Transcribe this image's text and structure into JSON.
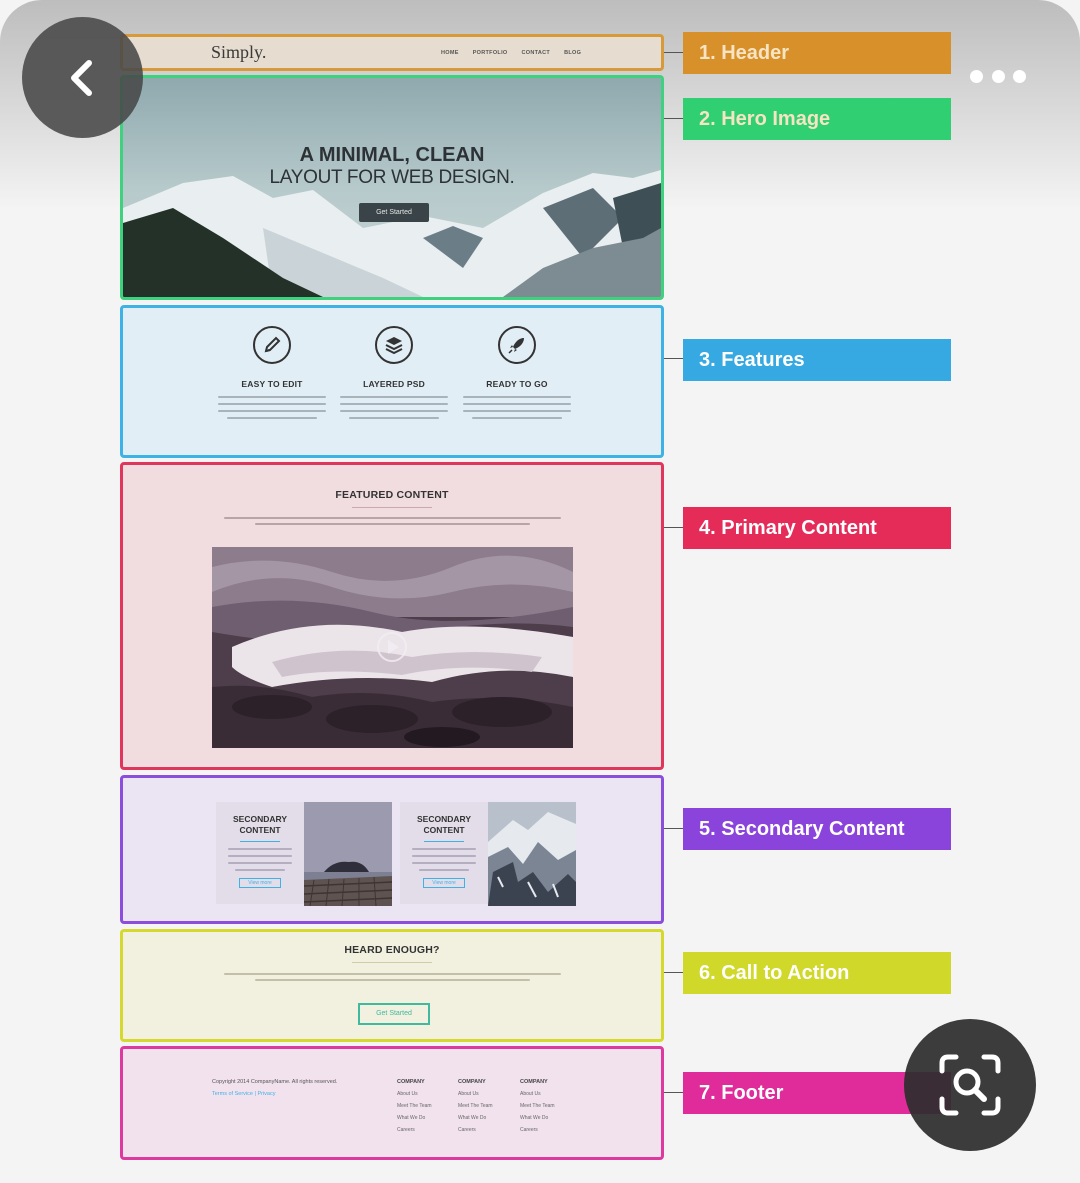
{
  "mockup": {
    "header": {
      "logo": "Simply.",
      "nav": [
        "HOME",
        "PORTFOLIO",
        "CONTACT",
        "BLOG"
      ]
    },
    "hero": {
      "title": "A MINIMAL, CLEAN",
      "subtitle": "LAYOUT FOR WEB DESIGN.",
      "button": "Get Started"
    },
    "features": [
      {
        "title": "EASY TO EDIT",
        "icon": "pencil-icon"
      },
      {
        "title": "LAYERED PSD",
        "icon": "layers-icon"
      },
      {
        "title": "READY TO GO",
        "icon": "rocket-icon"
      }
    ],
    "primary": {
      "title": "FEATURED CONTENT"
    },
    "secondary": {
      "cards": [
        {
          "title_line1": "SECONDARY",
          "title_line2": "CONTENT",
          "button": "View more"
        },
        {
          "title_line1": "SECONDARY",
          "title_line2": "CONTENT",
          "button": "View more"
        }
      ]
    },
    "cta": {
      "title": "HEARD ENOUGH?",
      "button": "Get Started"
    },
    "footer": {
      "copyright": "Copyright 2014 CompanyName. All rights reserved.",
      "terms": "Terms of Service | Privacy",
      "columns": [
        {
          "heading": "COMPANY",
          "items": [
            "About Us",
            "Meet The Team",
            "What We Do",
            "Careers"
          ]
        },
        {
          "heading": "COMPANY",
          "items": [
            "About Us",
            "Meet The Team",
            "What We Do",
            "Careers"
          ]
        },
        {
          "heading": "COMPANY",
          "items": [
            "About Us",
            "Meet The Team",
            "What We Do",
            "Careers"
          ]
        }
      ]
    }
  },
  "labels": [
    {
      "text": "1. Header",
      "color": "#d8902b"
    },
    {
      "text": "2. Hero Image",
      "color": "#2fcf72"
    },
    {
      "text": "3. Features",
      "color": "#36a9e2"
    },
    {
      "text": "4. Primary Content",
      "color": "#e52c58"
    },
    {
      "text": "5. Secondary Content",
      "color": "#8a44dc"
    },
    {
      "text": "6. Call to Action",
      "color": "#d0d82a"
    },
    {
      "text": "7. Footer",
      "color": "#df2c9a"
    }
  ],
  "overlay": {
    "back_icon": "chevron-left-icon",
    "more_icon": "more-dots-icon",
    "lens_icon": "visual-search-icon"
  }
}
